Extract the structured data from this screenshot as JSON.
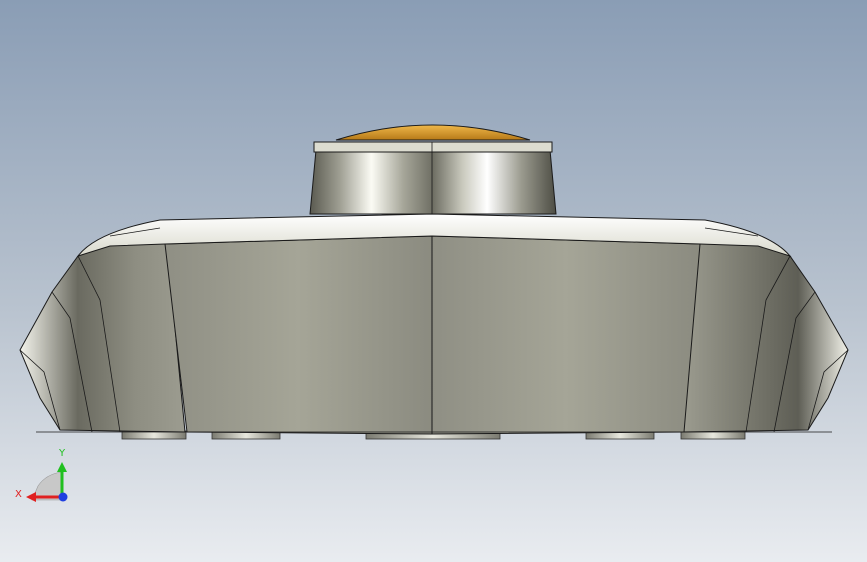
{
  "viewport": {
    "background_top": "#8a9db5",
    "background_bottom": "#e9ecf0"
  },
  "model": {
    "body_color": "#9a9a8e",
    "cap_color": "#d99a2e",
    "edge_color": "#1a1a1a"
  },
  "triad": {
    "x_label": "X",
    "y_label": "Y",
    "x_color": "#e02020",
    "y_color": "#20c020",
    "z_color": "#2040e0"
  }
}
